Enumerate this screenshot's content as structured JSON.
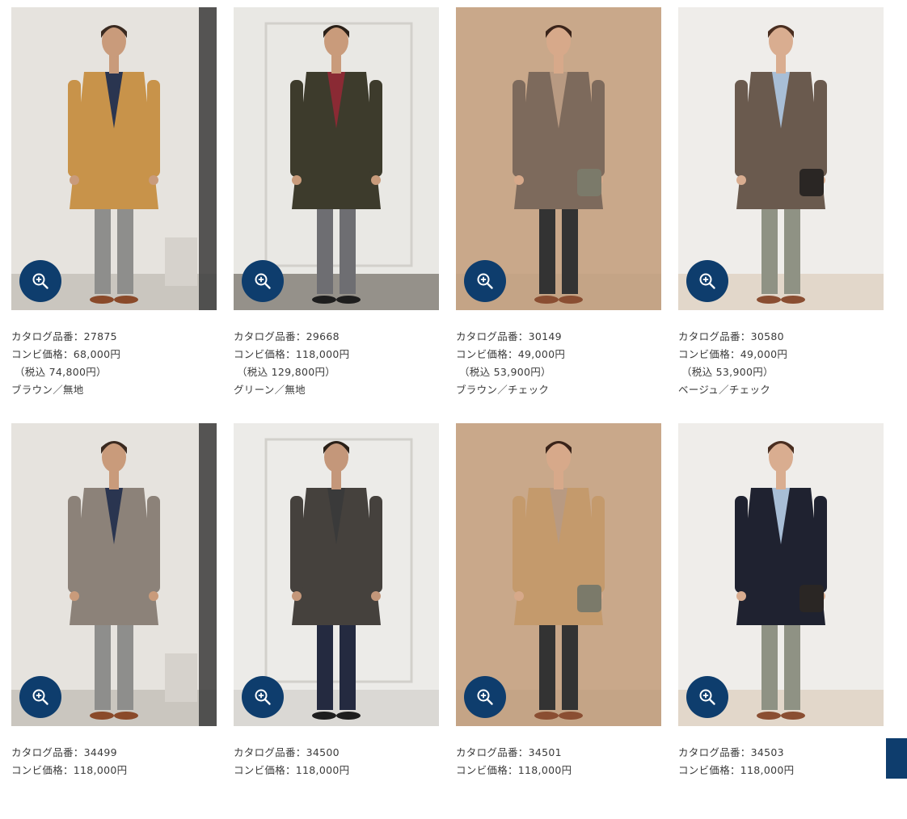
{
  "products": [
    {
      "catalog_label": "カタログ品番：27875",
      "price_label": "コンビ価格：68,000円",
      "tax_label": "（税込 74,800円）",
      "color_label": "ブラウン／無地",
      "icon": "zoom-in-icon",
      "colors": {
        "bg": "#e6e3de",
        "coat": "#c8934a",
        "pants": "#8e8e8c",
        "skin": "#c99b7b",
        "hair": "#3a2a20",
        "inner": "#2a3550",
        "floor": "#b8b2aa",
        "shoes": "#8a4a2a"
      }
    },
    {
      "catalog_label": "カタログ品番：29668",
      "price_label": "コンビ価格：118,000円",
      "tax_label": "（税込 129,800円）",
      "color_label": "グリーン／無地",
      "icon": "zoom-in-icon",
      "colors": {
        "bg": "#e9e8e4",
        "coat": "#3d3b2c",
        "pants": "#6e6e72",
        "skin": "#c99b7b",
        "hair": "#2a2018",
        "inner": "#8a2a34",
        "floor": "#5e564e",
        "shoes": "#1e1e1e"
      }
    },
    {
      "catalog_label": "カタログ品番：30149",
      "price_label": "コンビ価格：49,000円",
      "tax_label": "（税込 53,900円）",
      "color_label": "ブラウン／チェック",
      "icon": "zoom-in-icon",
      "colors": {
        "bg": "#c9a88a",
        "coat": "#7d6a5c",
        "pants": "#333333",
        "skin": "#d7a98a",
        "hair": "#3a241a",
        "inner": "#b89a82",
        "floor": "#c2a184",
        "shoes": "#8a4e32"
      }
    },
    {
      "catalog_label": "カタログ品番：30580",
      "price_label": "コンビ価格：49,000円",
      "tax_label": "（税込 53,900円）",
      "color_label": "ベージュ／チェック",
      "icon": "zoom-in-icon",
      "colors": {
        "bg": "#efedea",
        "coat": "#6a5a4e",
        "pants": "#8f9284",
        "skin": "#d9ad90",
        "hair": "#4a2e20",
        "inner": "#a8bed6",
        "floor": "#d8c8b4",
        "shoes": "#8a4e32"
      }
    },
    {
      "catalog_label": "カタログ品番：34499",
      "price_label": "コンビ価格：118,000円",
      "tax_label": "",
      "color_label": "",
      "icon": "zoom-in-icon",
      "colors": {
        "bg": "#e6e3de",
        "coat": "#8c8279",
        "pants": "#8e8e8c",
        "skin": "#c99b7b",
        "hair": "#3a2a20",
        "inner": "#2a3550",
        "floor": "#b8b2aa",
        "shoes": "#8a4a2a"
      }
    },
    {
      "catalog_label": "カタログ品番：34500",
      "price_label": "コンビ価格：118,000円",
      "tax_label": "",
      "color_label": "",
      "icon": "zoom-in-icon",
      "colors": {
        "bg": "#ecebe8",
        "coat": "#45413d",
        "pants": "#242a40",
        "skin": "#c4977a",
        "hair": "#2a2018",
        "inner": "#3a3a3a",
        "floor": "#cfccc7",
        "shoes": "#1e1e1e"
      }
    },
    {
      "catalog_label": "カタログ品番：34501",
      "price_label": "コンビ価格：118,000円",
      "tax_label": "",
      "color_label": "",
      "icon": "zoom-in-icon",
      "colors": {
        "bg": "#c9a88a",
        "coat": "#c49a6c",
        "pants": "#333333",
        "skin": "#d7a98a",
        "hair": "#3a241a",
        "inner": "#b89a82",
        "floor": "#c2a184",
        "shoes": "#8a4e32"
      }
    },
    {
      "catalog_label": "カタログ品番：34503",
      "price_label": "コンビ価格：118,000円",
      "tax_label": "",
      "color_label": "",
      "icon": "zoom-in-icon",
      "colors": {
        "bg": "#efedea",
        "coat": "#1f2230",
        "pants": "#8f9284",
        "skin": "#d9ad90",
        "hair": "#4a2e20",
        "inner": "#a8bed6",
        "floor": "#d8c8b4",
        "shoes": "#8a4e32"
      }
    }
  ],
  "back_to_top": {
    "icon": "back-to-top-icon",
    "color": "#0e3d6d"
  }
}
